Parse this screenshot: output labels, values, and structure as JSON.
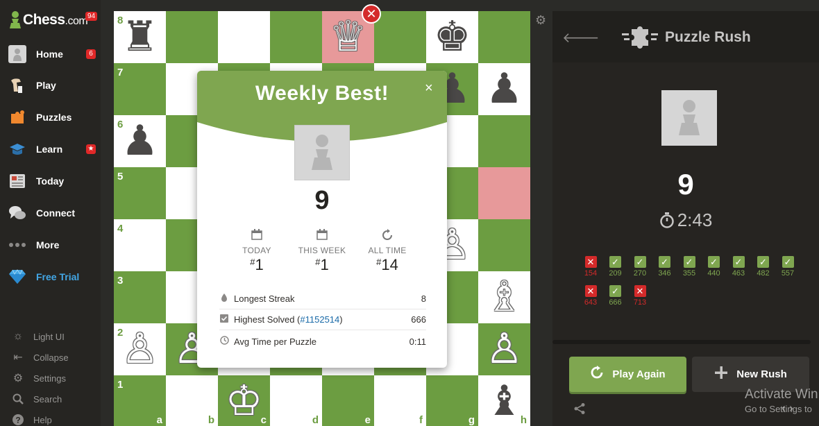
{
  "logo": {
    "brand": "Chess",
    "suffix": ".com",
    "badge": "94"
  },
  "sidebar": {
    "items": [
      {
        "label": "Home",
        "badge": "6"
      },
      {
        "label": "Play"
      },
      {
        "label": "Puzzles"
      },
      {
        "label": "Learn",
        "badge": "★"
      },
      {
        "label": "Today"
      },
      {
        "label": "Connect"
      },
      {
        "label": "More"
      },
      {
        "label": "Free Trial"
      }
    ],
    "bottom": [
      {
        "label": "Light UI"
      },
      {
        "label": "Collapse"
      },
      {
        "label": "Settings"
      },
      {
        "label": "Search"
      },
      {
        "label": "Help"
      }
    ]
  },
  "board": {
    "ranks": [
      "8",
      "7",
      "6",
      "5",
      "4",
      "3",
      "2",
      "1"
    ],
    "files": [
      "a",
      "b",
      "c",
      "d",
      "e",
      "f",
      "g",
      "h"
    ],
    "light_color": "#ffffff",
    "dark_color": "#6c9d41",
    "highlight_color": "#e7999a"
  },
  "modal": {
    "title": "Weekly Best!",
    "close": "×",
    "score": "9",
    "stats": [
      {
        "label": "TODAY",
        "rank": "1"
      },
      {
        "label": "THIS WEEK",
        "rank": "1"
      },
      {
        "label": "ALL TIME",
        "rank": "14"
      }
    ],
    "rank_prefix": "#",
    "rows": [
      {
        "label": "Longest Streak",
        "value": "8"
      },
      {
        "label_prefix": "Highest Solved (",
        "link": "#1152514",
        "label_suffix": ")",
        "value": "666"
      },
      {
        "label": "Avg Time per Puzzle",
        "value": "0:11"
      }
    ]
  },
  "right_panel": {
    "title": "Puzzle Rush",
    "score": "9",
    "timer": "2:43",
    "results": [
      {
        "ok": false,
        "value": "154"
      },
      {
        "ok": true,
        "value": "209"
      },
      {
        "ok": true,
        "value": "270"
      },
      {
        "ok": true,
        "value": "346"
      },
      {
        "ok": true,
        "value": "355"
      },
      {
        "ok": true,
        "value": "440"
      },
      {
        "ok": true,
        "value": "463"
      },
      {
        "ok": true,
        "value": "482"
      },
      {
        "ok": true,
        "value": "557"
      },
      {
        "ok": false,
        "value": "643"
      },
      {
        "ok": true,
        "value": "666"
      },
      {
        "ok": false,
        "value": "713"
      }
    ],
    "play_again": "Play Again",
    "new_rush": "New Rush"
  },
  "watermark": {
    "line1": "Activate Win",
    "line2": "Go to Settings to"
  },
  "colors": {
    "green": "#7fa650",
    "red": "#d42a2a",
    "link": "#1a6aa8"
  }
}
